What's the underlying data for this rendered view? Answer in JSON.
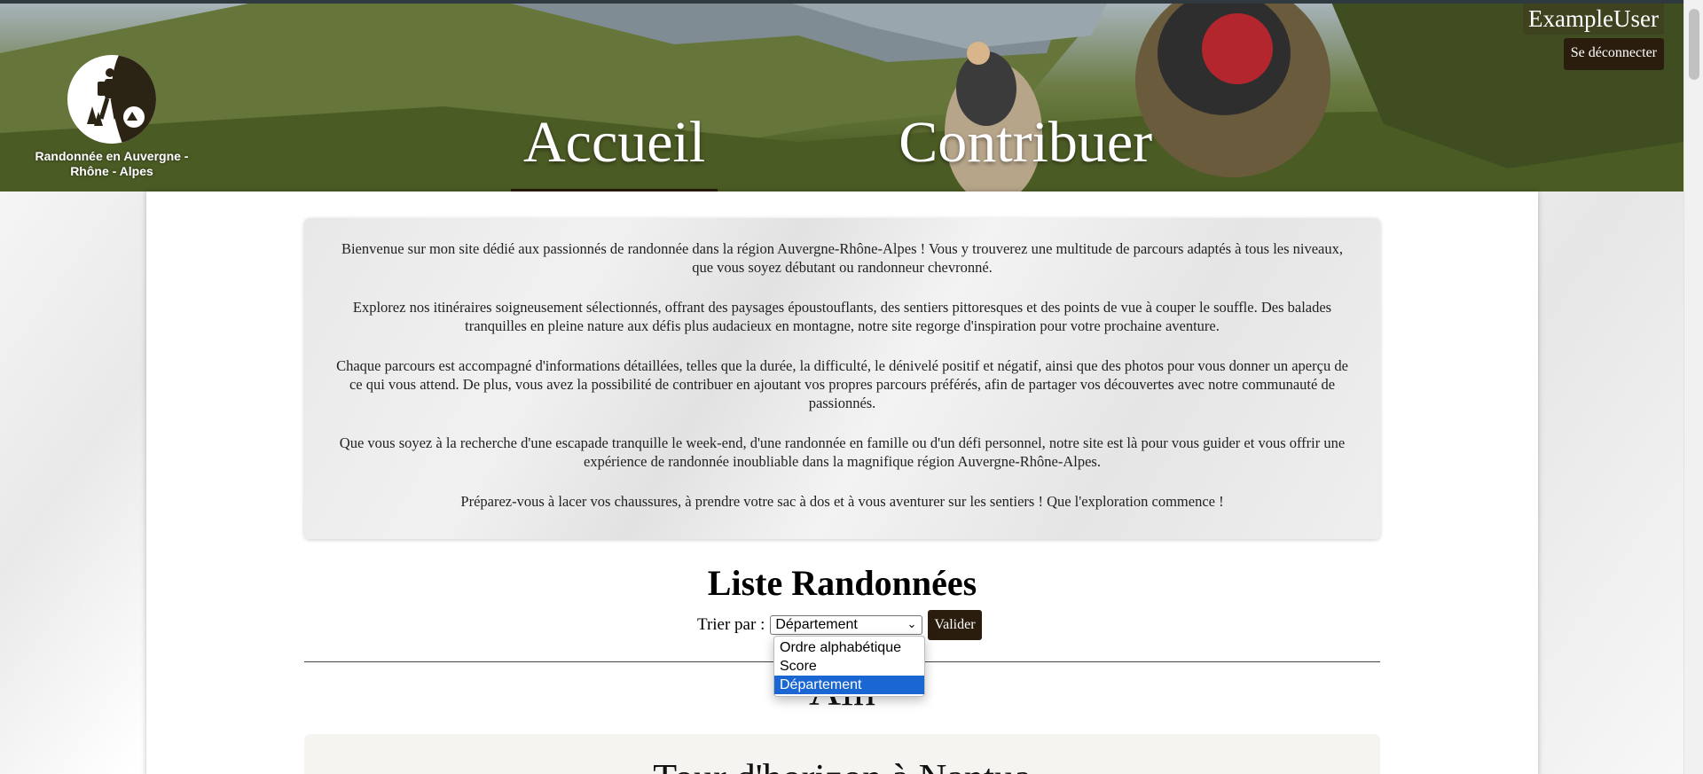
{
  "header": {
    "logo_text": "Randonnée en Auvergne - Rhône - Alpes",
    "nav": [
      {
        "label": "Accueil"
      },
      {
        "label": "Contribuer"
      }
    ],
    "user": {
      "name": "ExampleUser",
      "logout_label": "Se déconnecter"
    }
  },
  "intro": {
    "paragraphs": [
      "Bienvenue sur mon site dédié aux passionnés de randonnée dans la région Auvergne-Rhône-Alpes ! Vous y trouverez une multitude de parcours adaptés à tous les niveaux, que vous soyez débutant ou randonneur chevronné.",
      "Explorez nos itinéraires soigneusement sélectionnés, offrant des paysages époustouflants, des sentiers pittoresques et des points de vue à couper le souffle. Des balades tranquilles en pleine nature aux défis plus audacieux en montagne, notre site regorge d'inspiration pour votre prochaine aventure.",
      "Chaque parcours est accompagné d'informations détaillées, telles que la durée, la difficulté, le dénivelé positif et négatif, ainsi que des photos pour vous donner un aperçu de ce qui vous attend. De plus, vous avez la possibilité de contribuer en ajoutant vos propres parcours préférés, afin de partager vos découvertes avec notre communauté de passionnés.",
      "Que vous soyez à la recherche d'une escapade tranquille le week-end, d'une randonnée en famille ou d'un défi personnel, notre site est là pour vous guider et vous offrir une expérience de randonnée inoubliable dans la magnifique région Auvergne-Rhône-Alpes.",
      "Préparez-vous à lacer vos chaussures, à prendre votre sac à dos et à vous aventurer sur les sentiers ! Que l'exploration commence !"
    ]
  },
  "list": {
    "title": "Liste Randonnées",
    "sort_label": "Trier par :",
    "sort_selected": "Département",
    "sort_options": [
      "Ordre alphabétique",
      "Score",
      "Département"
    ],
    "submit_label": "Valider",
    "department": "Ain",
    "first_hike_title": "Tour d'horizon à Nantua"
  },
  "colors": {
    "accent_dark": "#2b1d0e",
    "selected_option": "#1a66d2"
  }
}
